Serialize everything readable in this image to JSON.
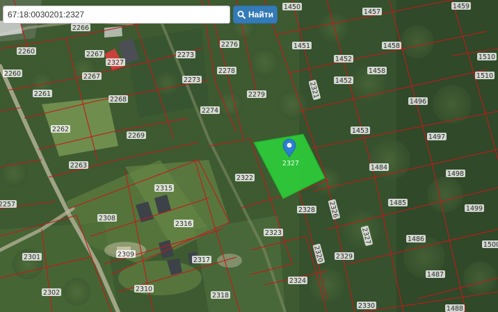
{
  "search": {
    "value": "67:18:0030201:2327",
    "button_label": "Найти",
    "button_icon": "search-icon"
  },
  "colors": {
    "parcel_border": "#c21a1a",
    "selected_fill": "#2bd63a",
    "marker": "#2a7fd1",
    "button": "#337ab7"
  },
  "selected_parcel": {
    "label": "2327"
  },
  "parcel_labels": [
    "2266",
    "2260",
    "2267",
    "2327",
    "2260",
    "2267",
    "2273",
    "2276",
    "2261",
    "2268",
    "2273",
    "2278",
    "2279",
    "2274",
    "2262",
    "2269",
    "2263",
    "2322",
    "2257",
    "2315",
    "2308",
    "2316",
    "2323",
    "2328",
    "2301",
    "2309",
    "2317",
    "2302",
    "2310",
    "2318",
    "2324",
    "2329",
    "2330",
    "1450",
    "1457",
    "1459",
    "1451",
    "1458",
    "1452",
    "1458",
    "1452",
    "1510",
    "1510",
    "1496",
    "1453",
    "1497",
    "1484",
    "1498",
    "1485",
    "1499",
    "1486",
    "1500",
    "1487",
    "1488",
    "2326",
    "2327",
    "2320",
    "2321"
  ]
}
